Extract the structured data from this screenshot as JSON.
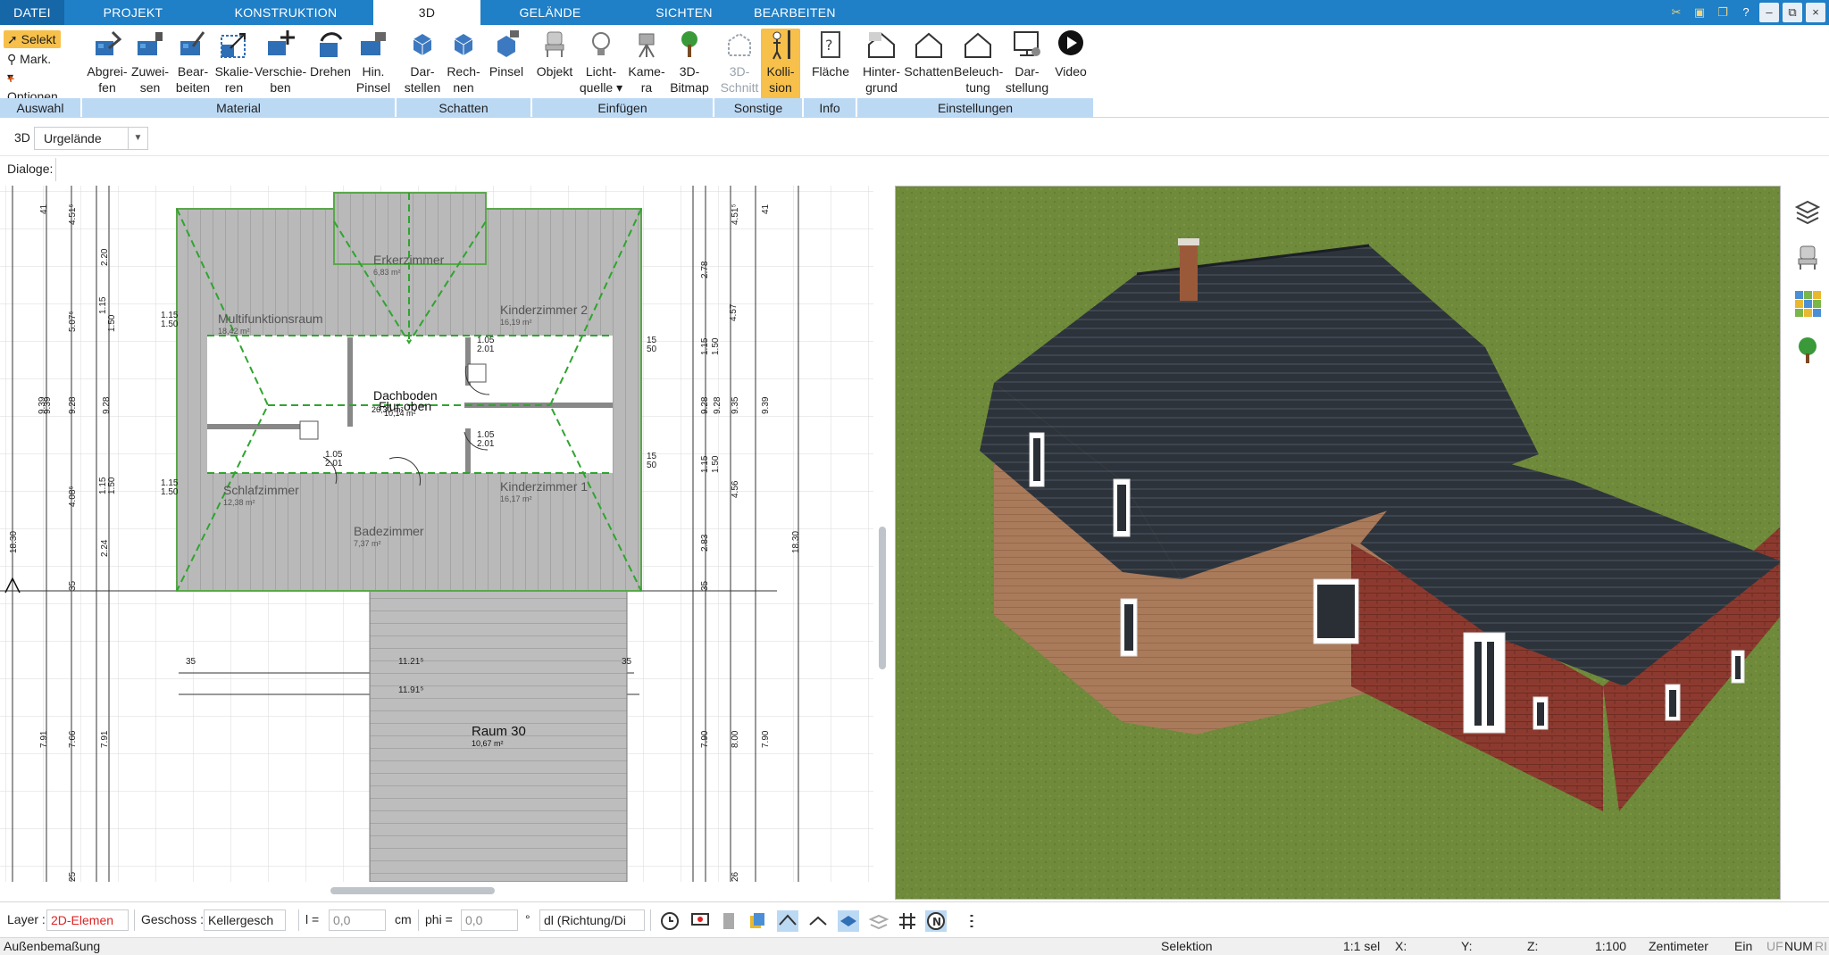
{
  "menu": {
    "tabs": [
      {
        "label": "DATEI"
      },
      {
        "label": "PROJEKT"
      },
      {
        "label": "KONSTRUKTION"
      },
      {
        "label": "3D"
      },
      {
        "label": "GELÄNDE"
      },
      {
        "label": "SICHTEN"
      },
      {
        "label": "BEARBEITEN"
      }
    ],
    "active_tab": "3D"
  },
  "ribbon": {
    "auswahl": {
      "selekt": "Selekt",
      "mark": "Mark.",
      "optionen": "Optionen",
      "group": "Auswahl"
    },
    "material": {
      "group": "Material",
      "buttons": [
        {
          "l1": "Abgrei-",
          "l2": "fen"
        },
        {
          "l1": "Zuwei-",
          "l2": "sen"
        },
        {
          "l1": "Bear-",
          "l2": "beiten"
        },
        {
          "l1": "Skalie-",
          "l2": "ren"
        },
        {
          "l1": "Verschie-",
          "l2": "ben"
        },
        {
          "l1": "Drehen",
          "l2": ""
        },
        {
          "l1": "Hin.",
          "l2": "Pinsel"
        }
      ]
    },
    "schatten": {
      "group": "Schatten",
      "buttons": [
        {
          "l1": "Dar-",
          "l2": "stellen"
        },
        {
          "l1": "Rech-",
          "l2": "nen"
        },
        {
          "l1": "Pinsel",
          "l2": ""
        }
      ]
    },
    "einfuegen": {
      "group": "Einfügen",
      "buttons": [
        {
          "l1": "Objekt",
          "l2": ""
        },
        {
          "l1": "Licht-",
          "l2": "quelle"
        },
        {
          "l1": "Kame-",
          "l2": "ra"
        },
        {
          "l1": "3D-",
          "l2": "Bitmap"
        }
      ]
    },
    "sonstige": {
      "group": "Sonstige",
      "buttons": [
        {
          "l1": "3D-",
          "l2": "Schnitt"
        },
        {
          "l1": "Kolli-",
          "l2": "sion"
        }
      ]
    },
    "info": {
      "group": "Info",
      "buttons": [
        {
          "l1": "Fläche",
          "l2": ""
        }
      ]
    },
    "einstellungen": {
      "group": "Einstellungen",
      "buttons": [
        {
          "l1": "Hinter-",
          "l2": "grund"
        },
        {
          "l1": "Schatten",
          "l2": ""
        },
        {
          "l1": "Beleuch-",
          "l2": "tung"
        },
        {
          "l1": "Dar-",
          "l2": "stellung"
        },
        {
          "l1": "Video",
          "l2": ""
        }
      ]
    }
  },
  "toolbar3d": {
    "label": "3D",
    "terrain_select": "Urgelände"
  },
  "dialoge": {
    "label": "Dialoge:"
  },
  "plan": {
    "rooms": [
      {
        "name": "Erkerzimmer",
        "area": "6,83 m²"
      },
      {
        "name": "Multifunktionsraum",
        "area": "18,42 m²"
      },
      {
        "name": "Kinderzimmer 2",
        "area": "16,19 m²"
      },
      {
        "name": "Dachboden",
        "area": "10,14 m²"
      },
      {
        "name": "Flur oben",
        "area": "26,30 m²"
      },
      {
        "name": "Schlafzimmer",
        "area": "12,38 m²"
      },
      {
        "name": "Kinderzimmer 1",
        "area": "16,17 m²"
      },
      {
        "name": "Badezimmer",
        "area": "7,37 m²"
      },
      {
        "name": "Raum 30",
        "area": "10,67 m²"
      }
    ],
    "dims_left": [
      "41",
      "4.51⁵",
      "2.20",
      "1.15",
      "5.07⁵",
      "1.50",
      "9.28",
      "9.28",
      "9.39",
      "9.39",
      "4.08⁵",
      "1.15",
      "1.50",
      "2.24",
      "18.30",
      "35",
      "7.91",
      "7.66",
      "7.91",
      "25"
    ],
    "dims_right": [
      "41",
      "4.51⁵",
      "2.78",
      "4.57",
      "1.15",
      "1.50",
      "9.28",
      "9.28",
      "9.35",
      "9.39",
      "1.15",
      "1.50",
      "4.56",
      "2.83",
      "18.30",
      "35",
      "7.90",
      "8.00",
      "7.90",
      "26"
    ],
    "dims_misc": [
      "1.05",
      "2.01",
      "1.05",
      "2.01",
      "1.05",
      "2.01",
      "1.15",
      "1.50",
      "1.15",
      "1.50",
      "15",
      "50",
      "15",
      "50",
      "35",
      "35",
      "11.21⁵",
      "11.91⁵"
    ]
  },
  "statusbar": {
    "layer_label": "Layer :",
    "layer_value": "2D-Elemen",
    "geschoss_label": "Geschoss :",
    "geschoss_value": "Kellergesch",
    "l_label": "l =",
    "l_value": "0,0",
    "l_unit": "cm",
    "phi_label": "phi =",
    "phi_value": "0,0",
    "phi_unit": "°",
    "dl_value": "dl (Richtung/Di"
  },
  "bottombar": {
    "left": "Außenbemaßung",
    "mode": "Selektion",
    "sel": "1:1 sel",
    "x": "X:",
    "y": "Y:",
    "z": "Z:",
    "scale": "1:100",
    "unit": "Zentimeter",
    "ein": "Ein",
    "uf": "UF",
    "num": "NUM",
    "ri": "RI"
  },
  "colors": {
    "menubar": "#1f7fc7",
    "accent": "#f7c04a",
    "group_bg": "#bcd9f4",
    "grass": "#6f8a3a",
    "roof": "#2c3138",
    "brick": "#8f3a2e",
    "plaster": "#a67a5a"
  }
}
